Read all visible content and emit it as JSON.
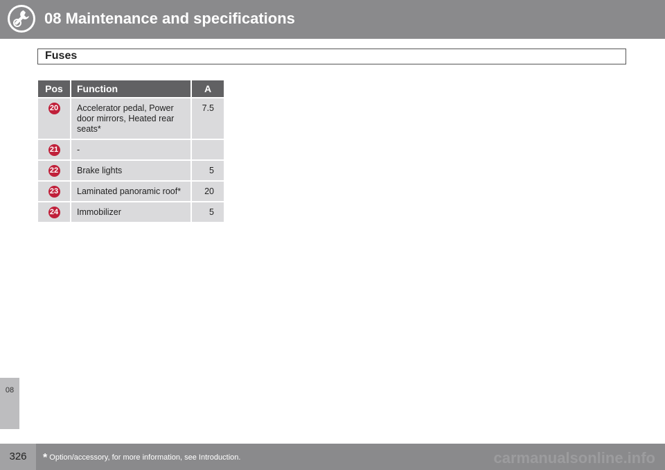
{
  "header": {
    "title": "08 Maintenance and specifications",
    "icon": "wrench-gear-icon"
  },
  "side_tab": {
    "label": "08"
  },
  "section": {
    "title": "Fuses"
  },
  "table": {
    "headers": {
      "pos": "Pos",
      "function": "Function",
      "amps": "A"
    },
    "rows": [
      {
        "pos": "20",
        "function": "Accelerator pedal, Power door mirrors, Heated rear seats*",
        "amps": "7.5"
      },
      {
        "pos": "21",
        "function": "-",
        "amps": ""
      },
      {
        "pos": "22",
        "function": "Brake lights",
        "amps": "5"
      },
      {
        "pos": "23",
        "function": "Laminated panoramic roof*",
        "amps": "20"
      },
      {
        "pos": "24",
        "function": "Immobilizer",
        "amps": "5"
      }
    ]
  },
  "footer": {
    "page_number": "326",
    "footnote_star": "*",
    "footnote": "Option/accessory, for more information, see Introduction.",
    "watermark": "carmanualsonline.info"
  },
  "colors": {
    "header_bg": "#8a8a8c",
    "table_header_bg": "#616163",
    "table_cell_bg": "#dadadc",
    "badge": "#c0203a"
  }
}
